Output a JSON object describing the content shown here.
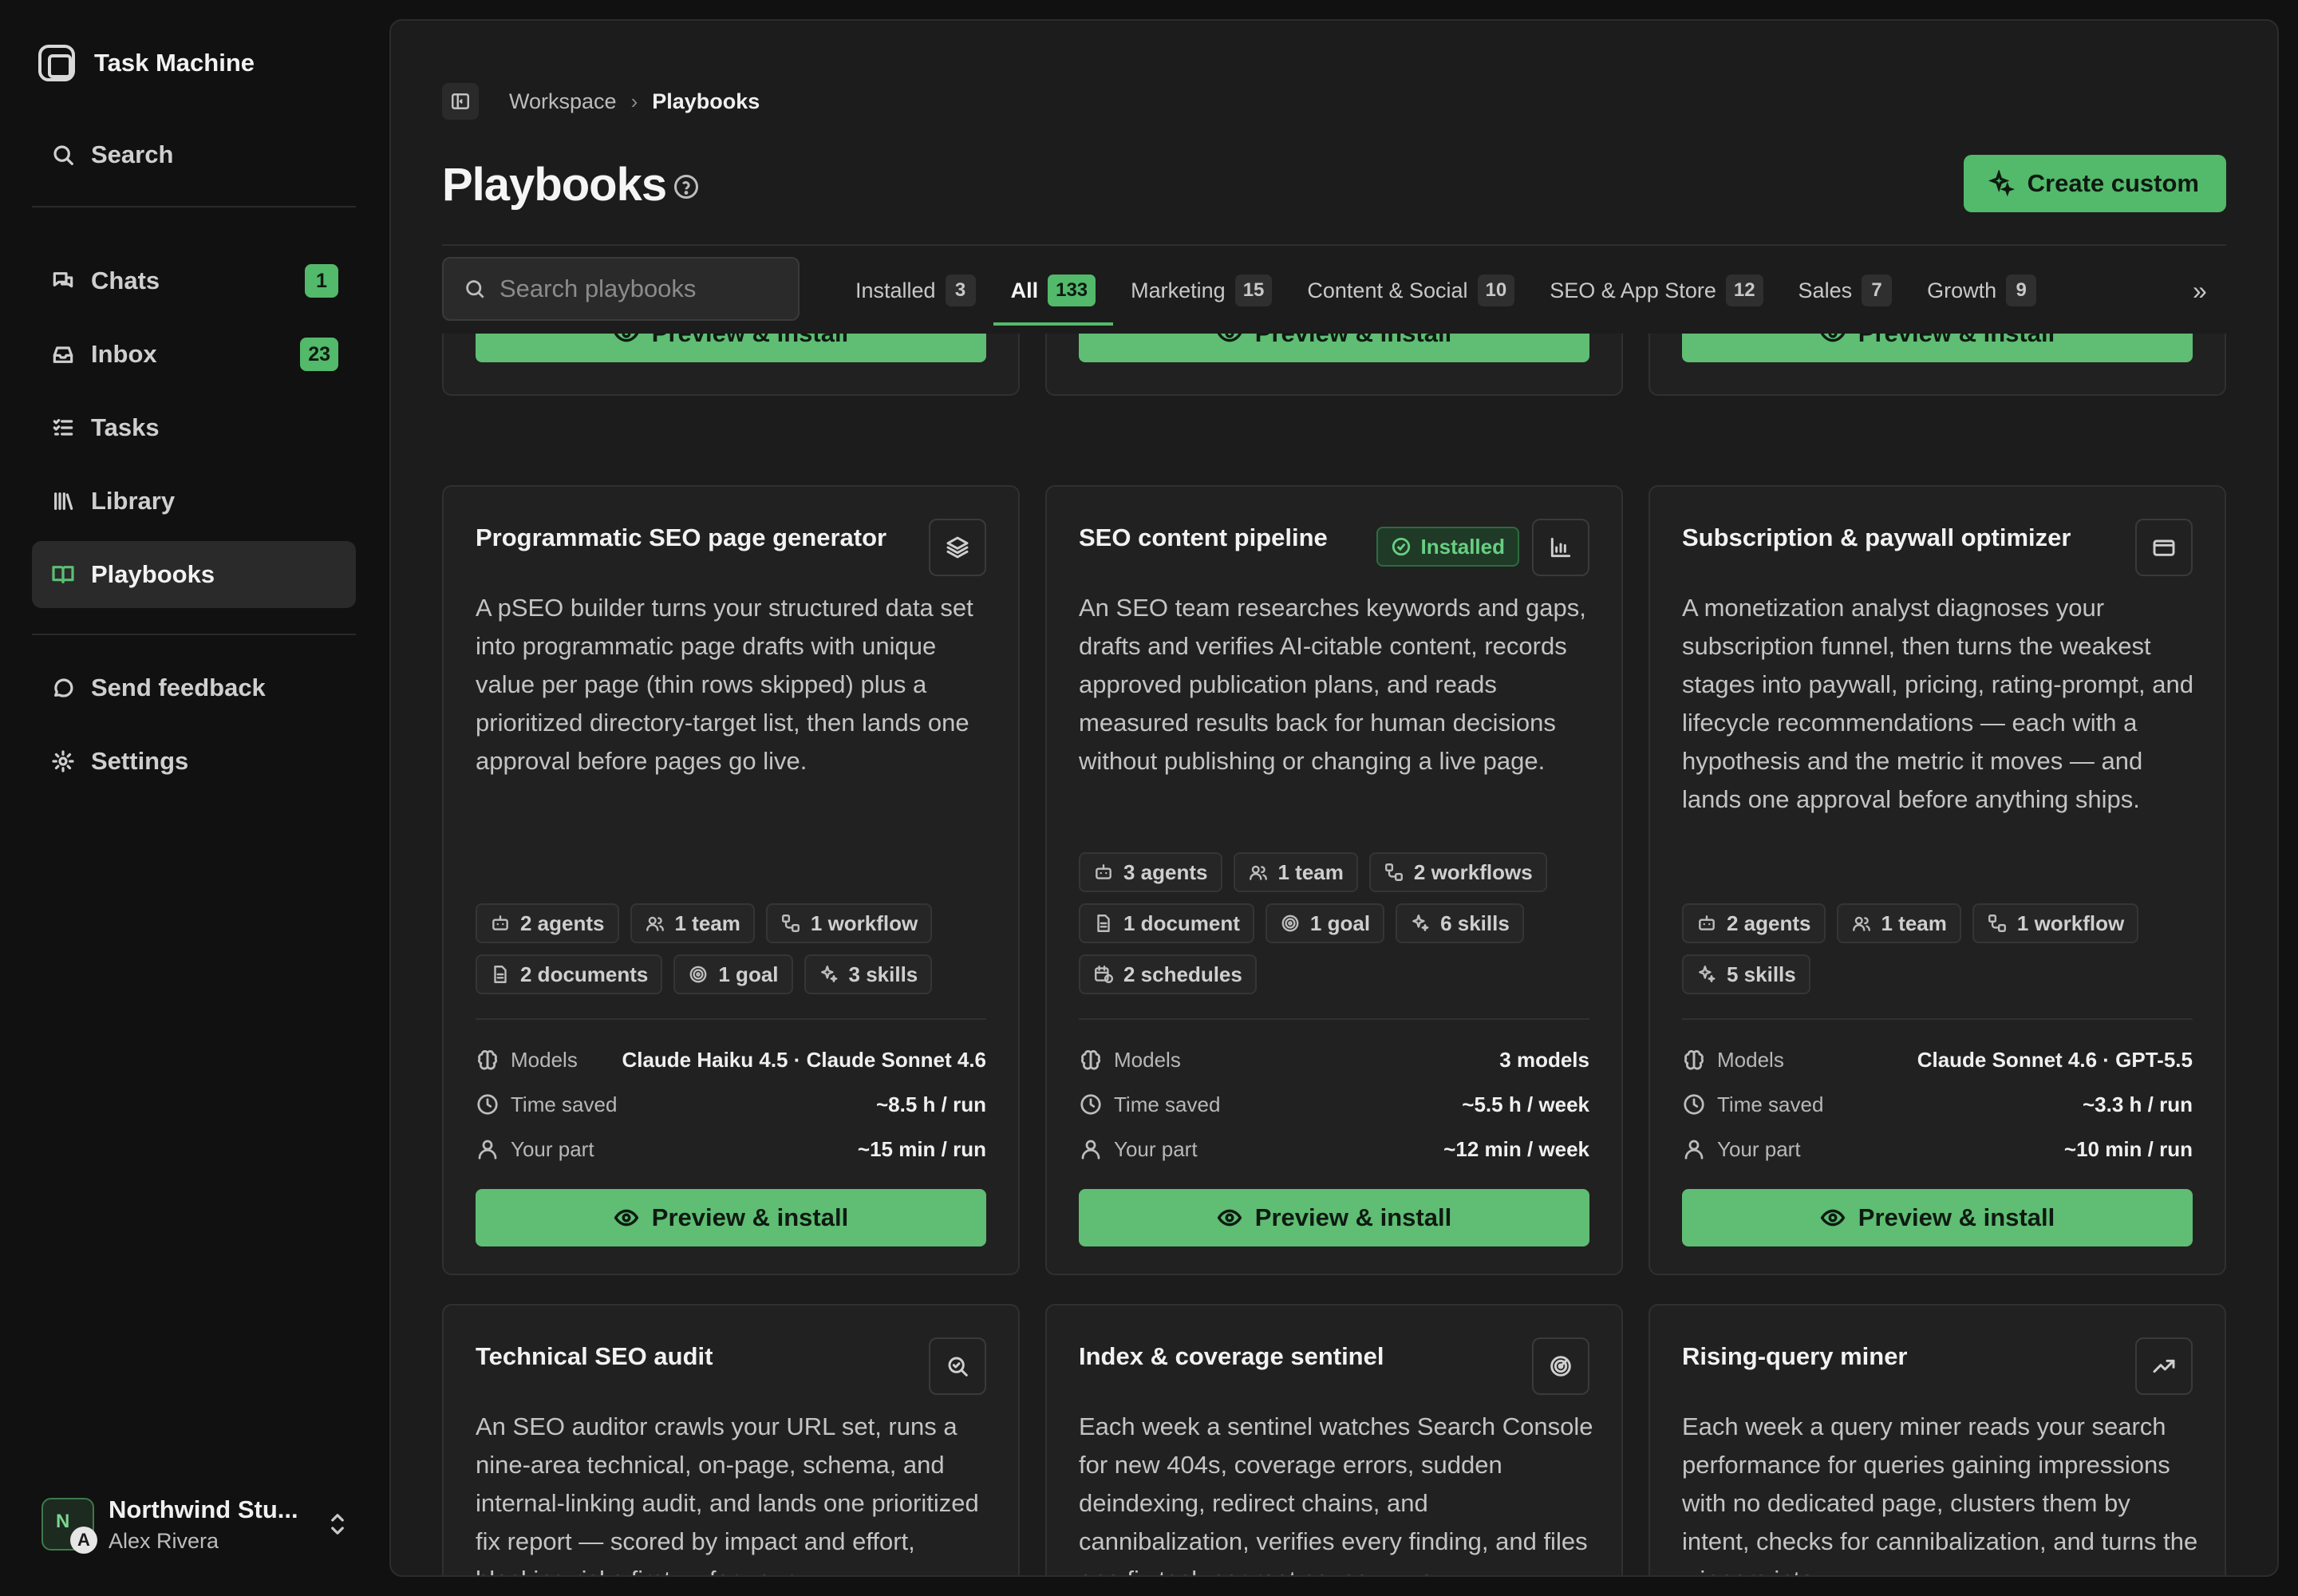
{
  "sidebar": {
    "brand": "Task Machine",
    "search": "Search",
    "items": [
      {
        "label": "Chats",
        "badge": "1"
      },
      {
        "label": "Inbox",
        "badge": "23"
      },
      {
        "label": "Tasks"
      },
      {
        "label": "Library"
      },
      {
        "label": "Playbooks"
      }
    ],
    "feedback": "Send feedback",
    "settings": "Settings",
    "account": {
      "org": "Northwind Stu...",
      "user": "Alex Rivera",
      "initial1": "N",
      "initial2": "A"
    }
  },
  "header": {
    "breadcrumb": [
      "Workspace",
      "Playbooks"
    ],
    "title": "Playbooks",
    "create_label": "Create custom"
  },
  "filters": {
    "search_placeholder": "Search playbooks",
    "tabs": [
      {
        "label": "Installed",
        "count": "3"
      },
      {
        "label": "All",
        "count": "133"
      },
      {
        "label": "Marketing",
        "count": "15"
      },
      {
        "label": "Content & Social",
        "count": "10"
      },
      {
        "label": "SEO & App Store",
        "count": "12"
      },
      {
        "label": "Sales",
        "count": "7"
      },
      {
        "label": "Growth",
        "count": "9"
      }
    ],
    "active_tab": "All"
  },
  "cards_top": [
    {
      "button": "Preview & install"
    },
    {
      "button": "Preview & install"
    },
    {
      "button": "Preview & install"
    }
  ],
  "cards": [
    {
      "title": "Programmatic SEO page generator",
      "icon": "layers-icon",
      "description": "A pSEO builder turns your structured data set into programmatic page drafts with unique value per page (thin rows skipped) plus a prioritized directory-target list, then lands one approval before pages go live.",
      "chips": [
        "2 agents",
        "1 team",
        "1 workflow",
        "2 documents",
        "1 goal",
        "3 skills"
      ],
      "models_label": "Models",
      "models": "Claude Haiku 4.5 · Claude Sonnet 4.6",
      "time_label": "Time saved",
      "time": "~8.5 h / run",
      "part_label": "Your part",
      "part": "~15 min / run",
      "button": "Preview & install"
    },
    {
      "title": "SEO content pipeline",
      "icon": "chart-icon",
      "installed": "Installed",
      "description": "An SEO team researches keywords and gaps, drafts and verifies AI-citable content, records approved publication plans, and reads measured results back for human decisions without publishing or changing a live page.",
      "chips": [
        "3 agents",
        "1 team",
        "2 workflows",
        "1 document",
        "1 goal",
        "6 skills",
        "2 schedules"
      ],
      "models_label": "Models",
      "models": "3 models",
      "time_label": "Time saved",
      "time": "~5.5 h / week",
      "part_label": "Your part",
      "part": "~12 min / week",
      "button": "Preview & install"
    },
    {
      "title": "Subscription & paywall optimizer",
      "icon": "card-icon",
      "description": "A monetization analyst diagnoses your subscription funnel, then turns the weakest stages into paywall, pricing, rating-prompt, and lifecycle recommendations — each with a hypothesis and the metric it moves — and lands one approval before anything ships.",
      "chips": [
        "2 agents",
        "1 team",
        "1 workflow",
        "5 skills"
      ],
      "models_label": "Models",
      "models": "Claude Sonnet 4.6 · GPT-5.5",
      "time_label": "Time saved",
      "time": "~3.3 h / run",
      "part_label": "Your part",
      "part": "~10 min / run",
      "button": "Preview & install"
    },
    {
      "title": "Technical SEO audit",
      "icon": "search-check-icon",
      "description": "An SEO auditor crawls your URL set, runs a nine-area technical, on-page, schema, and internal-linking audit, and lands one prioritized fix report — scored by impact and effort, blocking risks first — for your"
    },
    {
      "title": "Index & coverage sentinel",
      "icon": "radar-icon",
      "description": "Each week a sentinel watches Search Console for new 404s, coverage errors, sudden deindexing, redirect chains, and cannibalization, verifies every finding, and files one fix task per root cause — you"
    },
    {
      "title": "Rising-query miner",
      "icon": "trending-up-icon",
      "description": "Each week a query miner reads your search performance for queries gaining impressions with no dedicated page, clusters them by intent, checks for cannibalization, and turns the winners into"
    }
  ]
}
